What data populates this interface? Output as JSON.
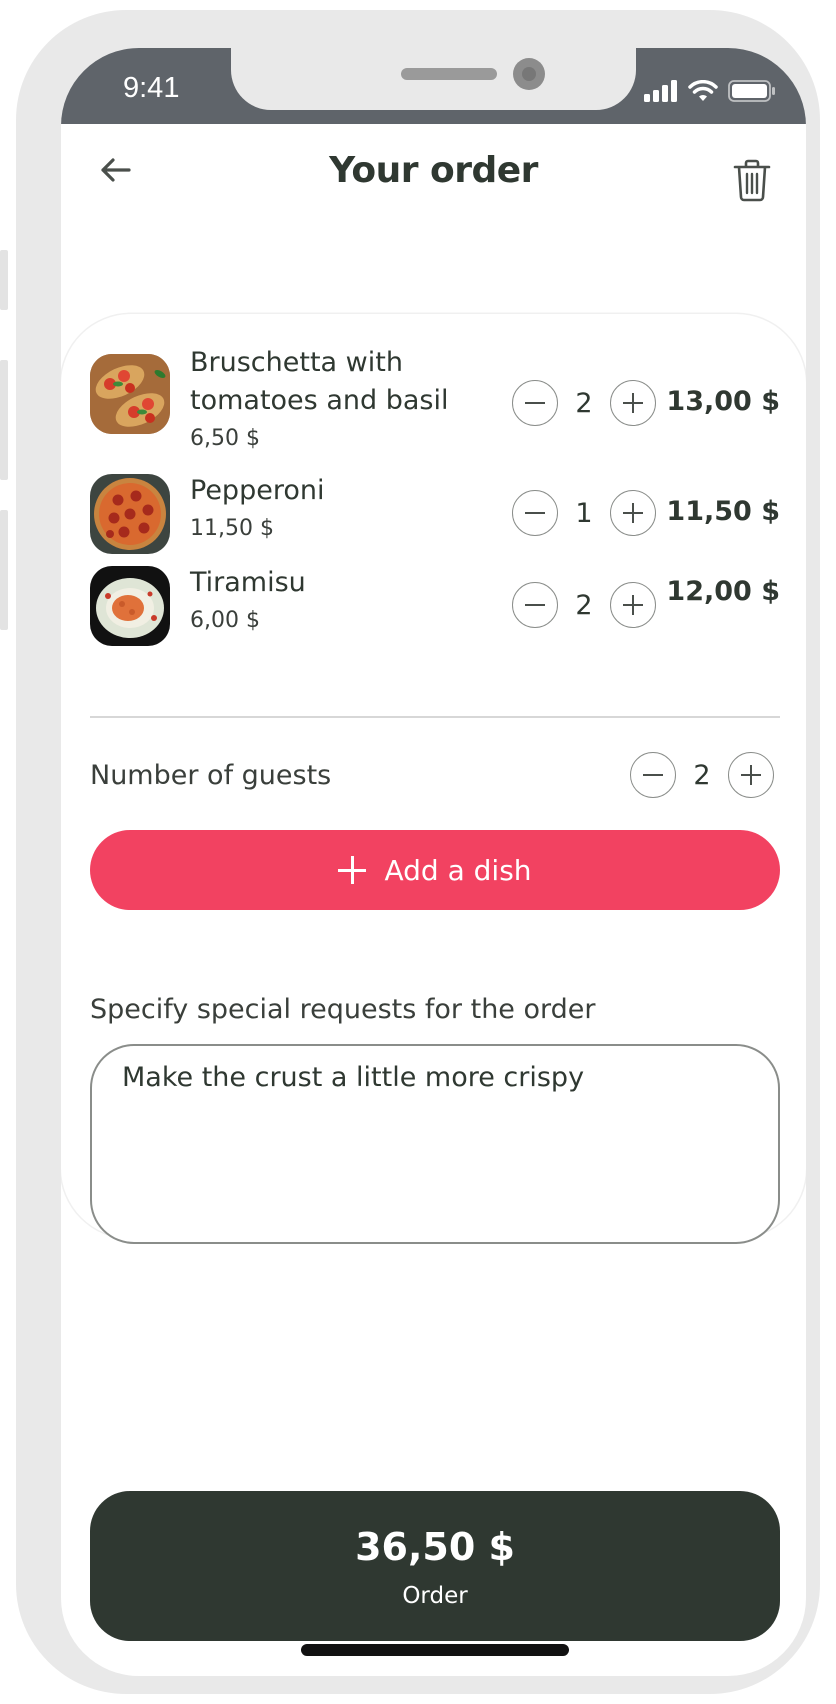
{
  "status_bar": {
    "time": "9:41",
    "icons": [
      "cellular-signal-icon",
      "wifi-icon",
      "battery-icon"
    ]
  },
  "header": {
    "title": "Your order",
    "back_icon": "arrow-left-icon",
    "trash_icon": "trash-icon"
  },
  "dishes": [
    {
      "name_line1": "Bruschetta with",
      "name_line2": "tomatoes and basil",
      "unit_price": "6,50 $",
      "quantity": "2",
      "total": "13,00 $"
    },
    {
      "name_line1": "Pepperoni",
      "name_line2": "",
      "unit_price": "11,50 $",
      "quantity": "1",
      "total": "11,50 $"
    },
    {
      "name_line1": "Tiramisu",
      "name_line2": "",
      "unit_price": "6,00 $",
      "quantity": "2",
      "total": "12,00 $"
    }
  ],
  "guests": {
    "label": "Number of guests",
    "quantity": "2"
  },
  "add_dish": {
    "label": "Add a dish"
  },
  "requests": {
    "label": "Specify special requests for the order",
    "value": "Make the crust a little more crispy"
  },
  "order": {
    "total": "36,50 $",
    "label": "Order"
  },
  "colors": {
    "accent": "#f24261",
    "dark": "#2f3831",
    "status_bar": "#5f646a"
  }
}
